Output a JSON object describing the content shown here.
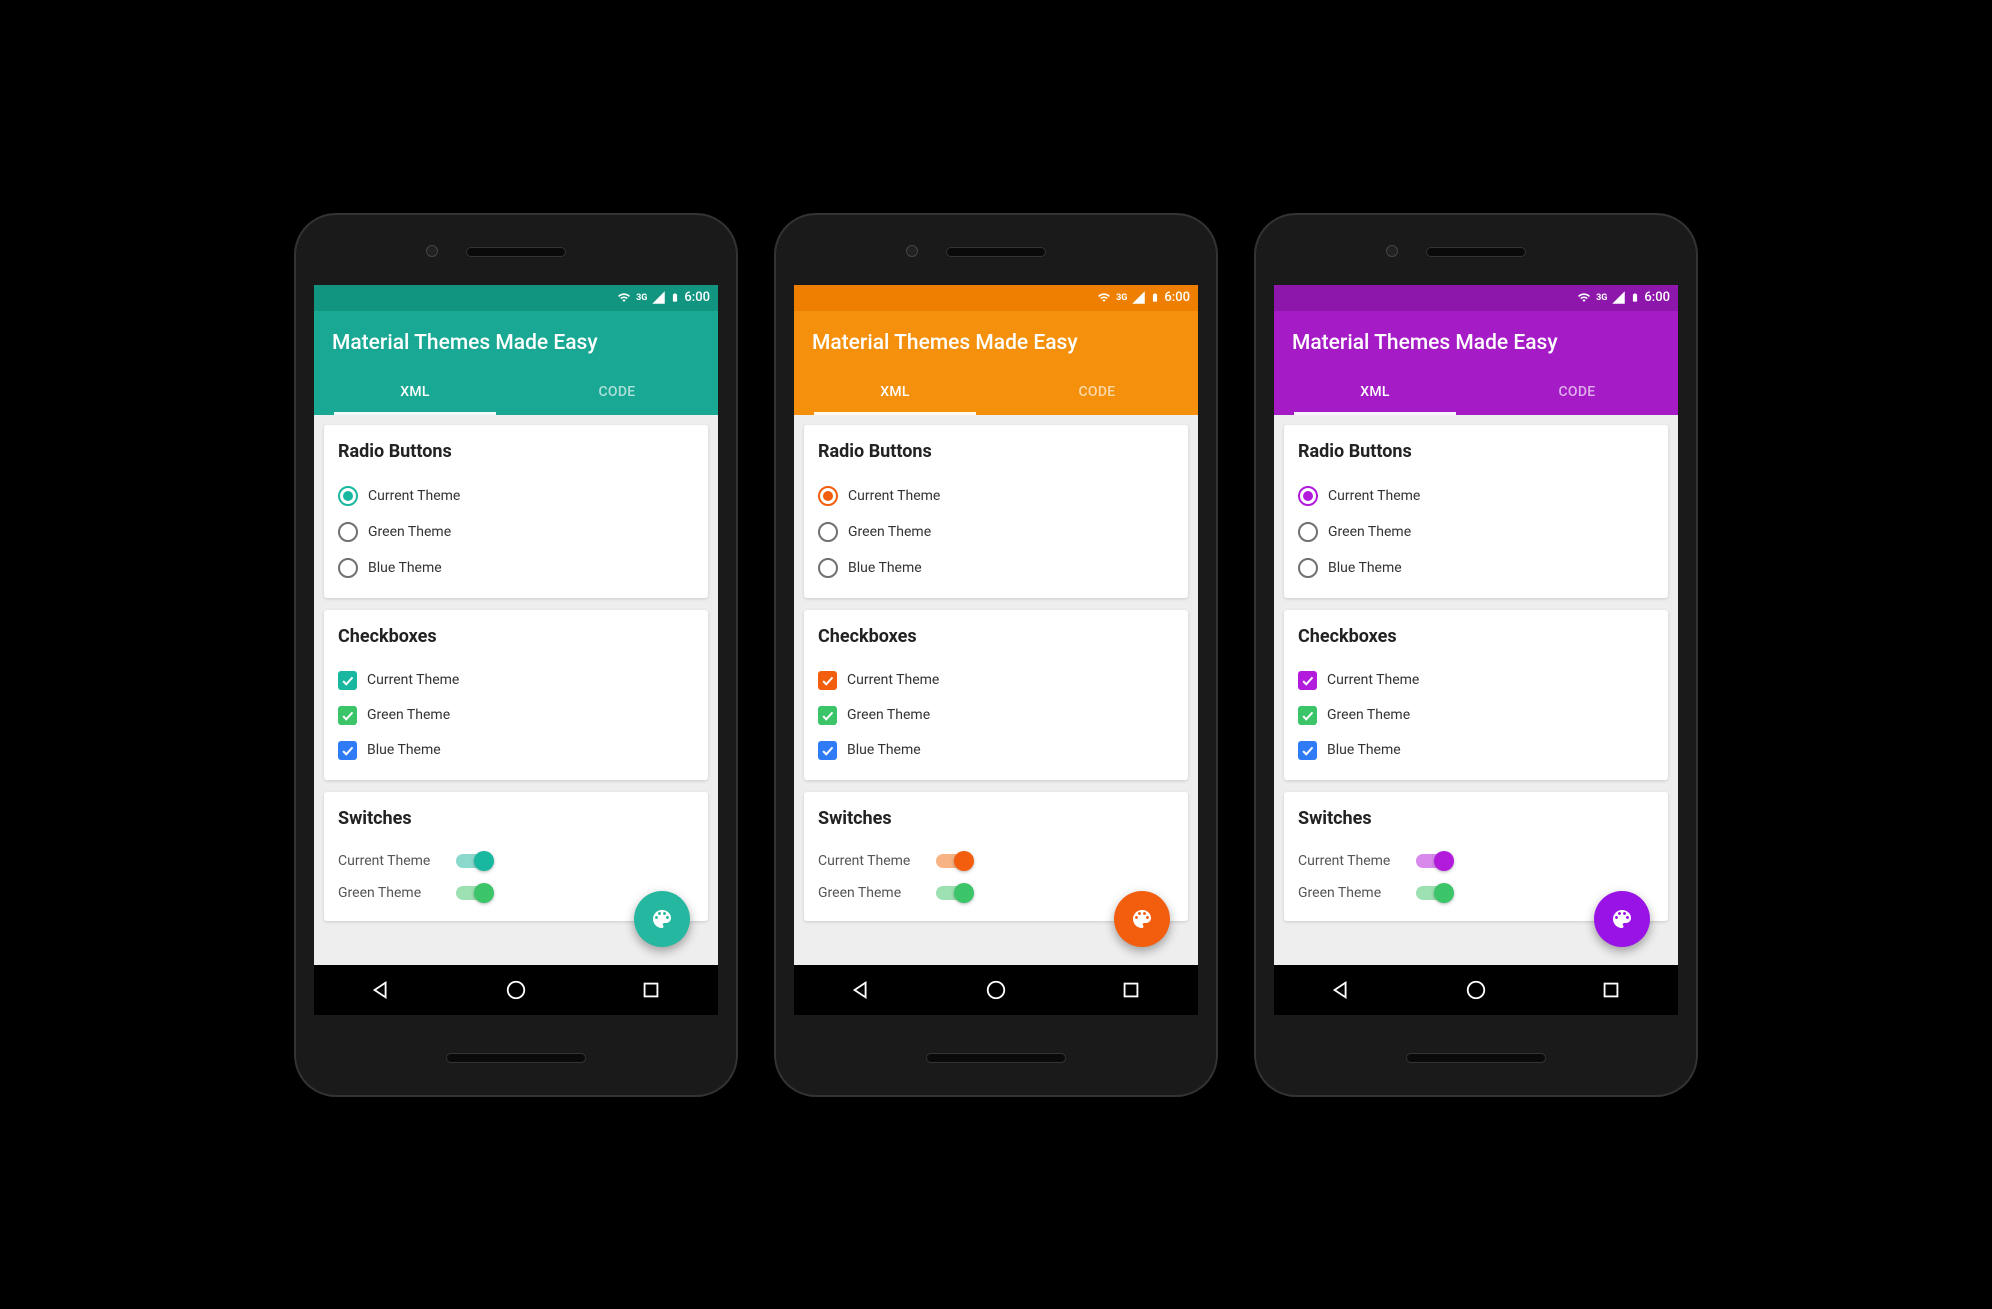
{
  "status": {
    "time": "6:00",
    "network": "3G"
  },
  "app_title": "Material Themes Made Easy",
  "tabs": {
    "xml": "XML",
    "code": "CODE"
  },
  "sections": {
    "radio": {
      "title": "Radio Buttons",
      "items": [
        "Current Theme",
        "Green Theme",
        "Blue Theme"
      ]
    },
    "checkbox": {
      "title": "Checkboxes",
      "items": [
        "Current Theme",
        "Green Theme",
        "Blue Theme"
      ]
    },
    "switch": {
      "title": "Switches",
      "items": [
        "Current Theme",
        "Green Theme"
      ]
    }
  },
  "colors": {
    "teal": {
      "primary": "#18a893",
      "dark": "#129580",
      "green": "#3cc468",
      "blue": "#2f7bf6"
    },
    "orange": {
      "primary": "#f4900b",
      "dark": "#ef7f00",
      "accent": "#f25d0e",
      "green": "#3cc468",
      "blue": "#2f7bf6"
    },
    "purple": {
      "primary": "#a51bc6",
      "dark": "#8d17ab",
      "green": "#3cc468",
      "blue": "#2f7bf6"
    }
  },
  "devices": [
    {
      "id": "teal",
      "accent": "#18a893",
      "status": "#129580",
      "fab": "#25b79f"
    },
    {
      "id": "orange",
      "accent": "#f25d0e",
      "status": "#ef7f00",
      "bar": "#f4900b",
      "fab": "#f25d0e"
    },
    {
      "id": "purple",
      "accent": "#a51bc6",
      "status": "#8d17ab",
      "fab": "#9913e6"
    }
  ]
}
